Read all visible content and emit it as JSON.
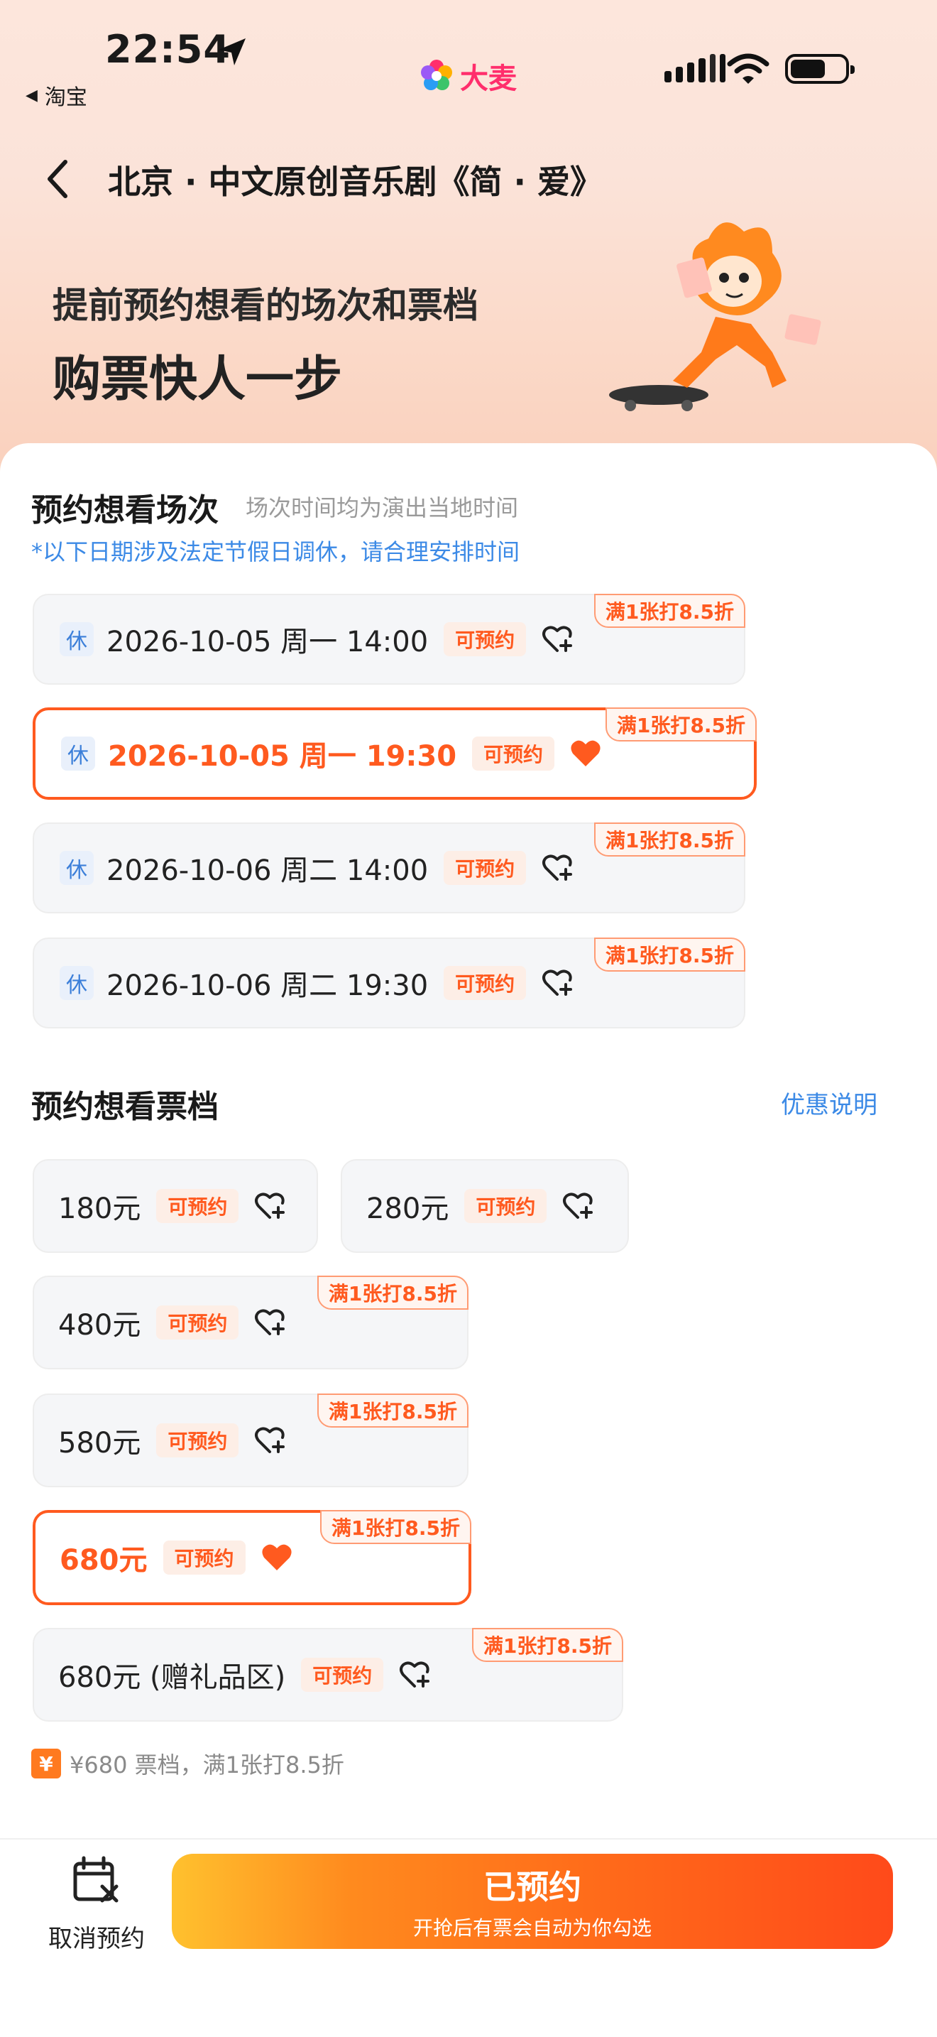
{
  "status_bar": {
    "time": "22:54",
    "back_app": "淘宝",
    "brand": "大麦"
  },
  "header": {
    "title": "北京 · 中文原创音乐剧《简 · 爱》"
  },
  "hero": {
    "line1": "提前预约想看的场次和票档",
    "line2": "购票快人一步"
  },
  "sessions": {
    "title": "预约想看场次",
    "subtitle": "场次时间均为演出当地时间",
    "holiday_note": "*以下日期涉及法定节假日调休，请合理安排时间",
    "items": [
      {
        "rest": "休",
        "text": "2026-10-05 周一 14:00",
        "status": "可预约",
        "discount": "满1张打8.5折",
        "selected": false
      },
      {
        "rest": "休",
        "text": "2026-10-05 周一 19:30",
        "status": "可预约",
        "discount": "满1张打8.5折",
        "selected": true
      },
      {
        "rest": "休",
        "text": "2026-10-06 周二 14:00",
        "status": "可预约",
        "discount": "满1张打8.5折",
        "selected": false
      },
      {
        "rest": "休",
        "text": "2026-10-06 周二 19:30",
        "status": "可预约",
        "discount": "满1张打8.5折",
        "selected": false
      }
    ]
  },
  "prices": {
    "title": "预约想看票档",
    "promo_link": "优惠说明",
    "items": [
      {
        "text": "180元",
        "status": "可预约",
        "discount": "",
        "selected": false
      },
      {
        "text": "280元",
        "status": "可预约",
        "discount": "",
        "selected": false
      },
      {
        "text": "480元",
        "status": "可预约",
        "discount": "满1张打8.5折",
        "selected": false
      },
      {
        "text": "580元",
        "status": "可预约",
        "discount": "满1张打8.5折",
        "selected": false
      },
      {
        "text": "680元",
        "status": "可预约",
        "discount": "满1张打8.5折",
        "selected": true
      },
      {
        "text": "680元 (赠礼品区)",
        "status": "可预约",
        "discount": "满1张打8.5折",
        "selected": false
      }
    ]
  },
  "notice": {
    "icon": "¥",
    "text": "¥680 票档，满1张打8.5折"
  },
  "bottom": {
    "cancel_label": "取消预约",
    "button_title": "已预约",
    "button_sub": "开抢后有票会自动为你勾选"
  },
  "colors": {
    "accent": "#ff5a1f",
    "link": "#3c8ae6",
    "brand": "#ff2e6c"
  }
}
